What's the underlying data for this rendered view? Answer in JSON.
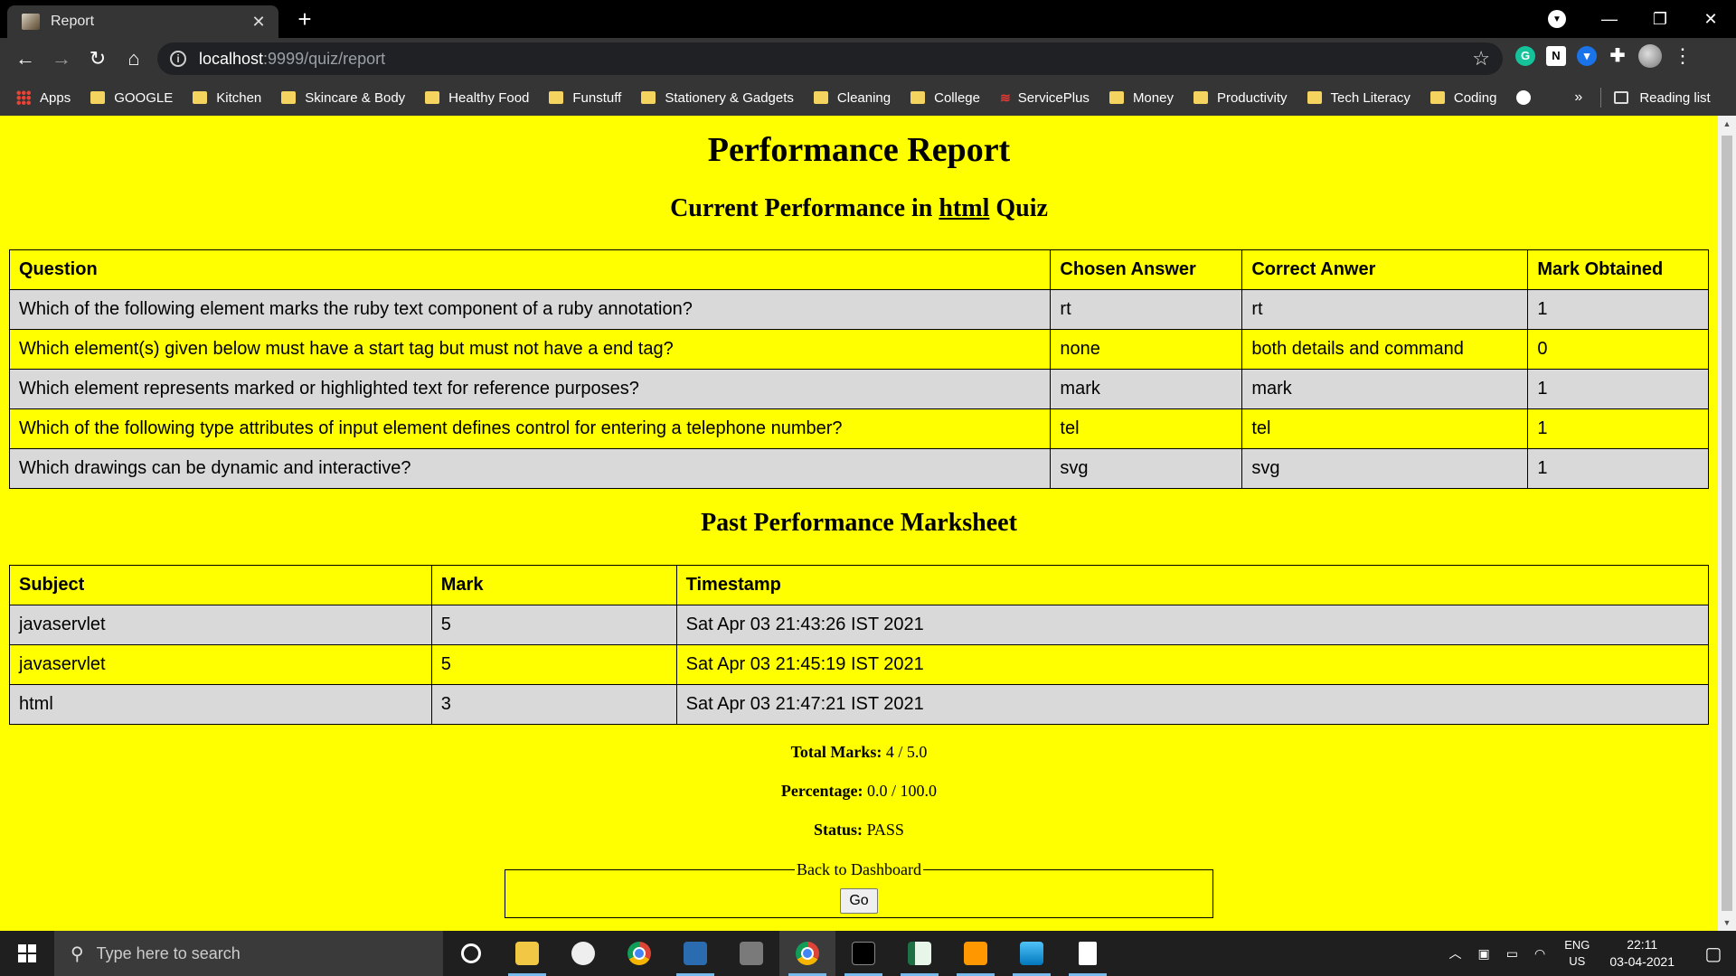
{
  "browser": {
    "tab_title": "Report",
    "tab_close": "✕",
    "new_tab": "+",
    "url_host": "localhost",
    "url_rest": ":9999/quiz/report",
    "bookmarks": [
      "GOOGLE",
      "Kitchen",
      "Skincare & Body",
      "Healthy Food",
      "Funstuff",
      "Stationery & Gadgets",
      "Cleaning",
      "College",
      "ServicePlus",
      "Money",
      "Productivity",
      "Tech Literacy",
      "Coding"
    ],
    "apps_label": "Apps",
    "more_label": "»",
    "reading_list": "Reading list"
  },
  "page": {
    "title": "Performance Report",
    "current_prefix": "Current Performance in",
    "current_subject": "html",
    "current_suffix": "Quiz",
    "current_table": {
      "headers": [
        "Question",
        "Chosen Answer",
        "Correct Anwer",
        "Mark Obtained"
      ],
      "rows": [
        [
          "Which of the following element marks the ruby text component of a ruby annotation?",
          "rt",
          "rt",
          "1"
        ],
        [
          "Which element(s) given below must have a start tag but must not have a end tag?",
          "none",
          "both details and command",
          "0"
        ],
        [
          "Which element represents marked or highlighted text for reference purposes?",
          "mark",
          "mark",
          "1"
        ],
        [
          "Which of the following type attributes of input element defines control for entering a telephone number?",
          "tel",
          "tel",
          "1"
        ],
        [
          "Which drawings can be dynamic and interactive?",
          "svg",
          "svg",
          "1"
        ]
      ]
    },
    "past_title": "Past Performance Marksheet",
    "past_table": {
      "headers": [
        "Subject",
        "Mark",
        "Timestamp"
      ],
      "rows": [
        [
          "javaservlet",
          "5",
          "Sat Apr 03 21:43:26 IST 2021"
        ],
        [
          "javaservlet",
          "5",
          "Sat Apr 03 21:45:19 IST 2021"
        ],
        [
          "html",
          "3",
          "Sat Apr 03 21:47:21 IST 2021"
        ]
      ]
    },
    "summary": {
      "total_label": "Total Marks:",
      "total_value": "4 / 5.0",
      "percentage_label": "Percentage:",
      "percentage_value": "0.0 / 100.0",
      "status_label": "Status:",
      "status_value": "PASS"
    },
    "back_legend": "Back to Dashboard",
    "go_label": "Go"
  },
  "taskbar": {
    "search_placeholder": "Type here to search",
    "lang_top": "ENG",
    "lang_bottom": "US",
    "time": "22:11",
    "date": "03-04-2021"
  },
  "colors": {
    "page_bg": "#ffff00",
    "row_alt": "#d9d9d9",
    "browser_chrome": "#353535"
  }
}
